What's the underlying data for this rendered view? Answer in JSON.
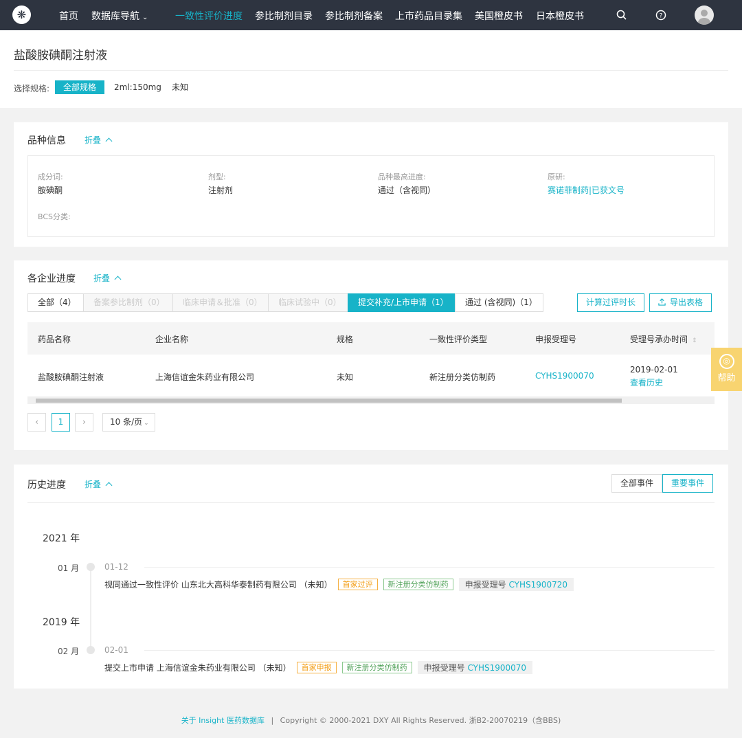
{
  "nav": {
    "items": [
      "首页",
      "数据库导航",
      "一致性评价进度",
      "参比制剂目录",
      "参比制剂备案",
      "上市药品目录集",
      "美国橙皮书",
      "日本橙皮书"
    ],
    "active_index": 2,
    "dropdown_index": 1,
    "icons": [
      "search-icon",
      "help-icon",
      "user-avatar"
    ]
  },
  "header": {
    "title": "盐酸胺碘酮注射液",
    "spec_label": "选择规格:",
    "spec_options": [
      "全部规格",
      "2ml:150mg",
      "未知"
    ],
    "spec_selected": 0
  },
  "variety": {
    "title": "品种信息",
    "fold": "折叠",
    "fields": [
      {
        "label": "成分词:",
        "value": "胺碘酮"
      },
      {
        "label": "剂型:",
        "value": "注射剂"
      },
      {
        "label": "品种最高进度:",
        "value": "通过（含视同）"
      },
      {
        "label": "原研:",
        "value": "赛诺菲制药|已获文号"
      },
      {
        "label": "BCS分类:",
        "value": ""
      }
    ]
  },
  "progress": {
    "title": "各企业进度",
    "fold": "折叠",
    "tabs": [
      "全部（4）",
      "备案参比制剂（0）",
      "临床申请＆批准（0）",
      "临床试验中（0）",
      "提交补充/上市申请（1）",
      "通过 (含视同)（1）"
    ],
    "active_tab": 4,
    "actions": [
      "计算过评时长",
      "导出表格"
    ],
    "columns": [
      "药品名称",
      "企业名称",
      "规格",
      "一致性评价类型",
      "申报受理号",
      "受理号承办时间"
    ],
    "rows": [
      {
        "drug": "盐酸胺碘酮注射液",
        "company": "上海信谊金朱药业有限公司",
        "spec": "未知",
        "type": "新注册分类仿制药",
        "accept_no": "CYHS1900070",
        "date": "2019-02-01",
        "history_link": "查看历史"
      }
    ],
    "pager": {
      "current": "1",
      "page_size": "10 条/页"
    }
  },
  "help_float": {
    "label": "帮助"
  },
  "history": {
    "title": "历史进度",
    "fold": "折叠",
    "filters": [
      "全部事件",
      "重要事件"
    ],
    "active_filter": 1,
    "groups": [
      {
        "year": "2021 年",
        "month": "01 月",
        "date": "01-12",
        "event": "视同通过一致性评价 山东北大高科华泰制药有限公司 （未知）",
        "tags": [
          "首家过评",
          "新注册分类仿制药"
        ],
        "accept_label": "申报受理号",
        "accept_no": "CYHS1900720"
      },
      {
        "year": "2019 年",
        "month": "02 月",
        "date": "02-01",
        "event": "提交上市申请 上海信谊金朱药业有限公司 （未知）",
        "tags": [
          "首家申报",
          "新注册分类仿制药"
        ],
        "accept_label": "申报受理号",
        "accept_no": "CYHS1900070"
      }
    ]
  },
  "footer": {
    "link": "关于 Insight 医药数据库",
    "sep": "|",
    "text": "Copyright © 2000-2021 DXY All Rights Reserved. 浙B2-20070219（含BBS)"
  },
  "colors": {
    "accent": "#17b3c8",
    "nav_bg": "#2e3440",
    "help_bg": "#f8d470"
  }
}
